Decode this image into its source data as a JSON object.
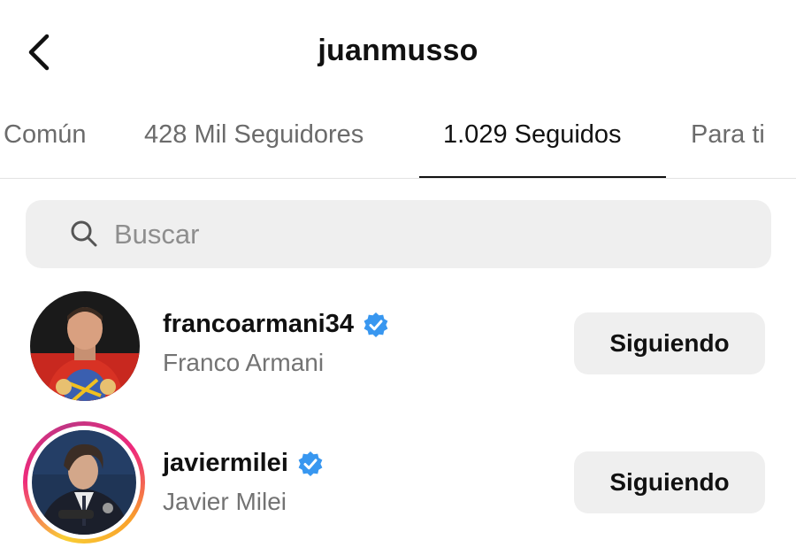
{
  "header": {
    "title": "juanmusso",
    "back_icon": "chevron-left-icon"
  },
  "tabs": [
    {
      "label": "Común",
      "active": false
    },
    {
      "label": "428 Mil Seguidores",
      "active": false
    },
    {
      "label": "1.029 Seguidos",
      "active": true
    },
    {
      "label": "Para ti",
      "active": false
    }
  ],
  "search": {
    "placeholder": "Buscar",
    "value": "",
    "icon": "search-icon"
  },
  "accounts": [
    {
      "username": "francoarmani34",
      "full_name": "Franco Armani",
      "verified": true,
      "has_story": false,
      "button_label": "Siguiendo"
    },
    {
      "username": "javiermilei",
      "full_name": "Javier Milei",
      "verified": true,
      "has_story": true,
      "button_label": "Siguiendo"
    }
  ],
  "colors": {
    "verified_badge": "#3897f0",
    "button_bg": "#efefef",
    "secondary_text": "#737373"
  }
}
